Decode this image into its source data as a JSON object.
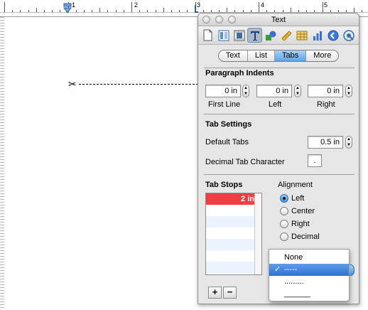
{
  "ruler": {
    "numbers": [
      "1",
      "2",
      "3",
      "4",
      "5"
    ]
  },
  "document": {
    "scissor_glyph": "✂"
  },
  "panel": {
    "title": "Text",
    "tabs": [
      "Text",
      "List",
      "Tabs",
      "More"
    ],
    "active_tab": "Tabs",
    "paragraph_indents": {
      "title": "Paragraph Indents",
      "first_line": {
        "value": "0 in",
        "label": "First Line"
      },
      "left": {
        "value": "0 in",
        "label": "Left"
      },
      "right": {
        "value": "0 in",
        "label": "Right"
      }
    },
    "tab_settings": {
      "title": "Tab Settings",
      "default_tabs_label": "Default Tabs",
      "default_tabs_value": "0.5 in",
      "decimal_label": "Decimal Tab Character",
      "decimal_value": "."
    },
    "tab_stops": {
      "title": "Tab Stops",
      "rows": [
        "2 in",
        "",
        "",
        "",
        "",
        "",
        ""
      ],
      "selected_index": 0,
      "add_label": "+",
      "remove_label": "−"
    },
    "alignment": {
      "title": "Alignment",
      "options": [
        "Left",
        "Center",
        "Right",
        "Decimal"
      ],
      "selected": "Left"
    },
    "leader_menu": {
      "options": [
        "None",
        "-----",
        ".........",
        "______"
      ],
      "selected_index": 1,
      "check": "✓"
    }
  },
  "colors": {
    "selected_row": "#ef3e44",
    "accent": "#3e8fe0"
  }
}
